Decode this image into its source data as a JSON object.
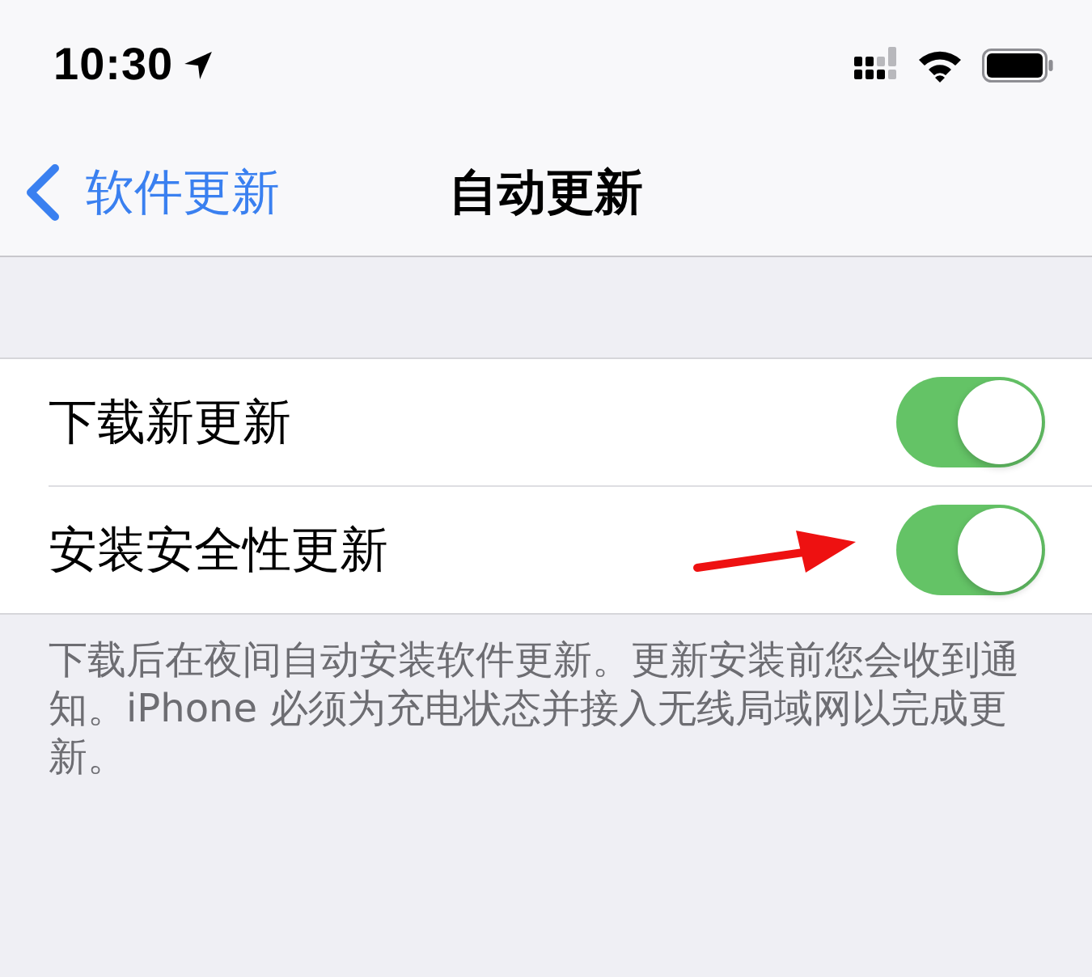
{
  "status_bar": {
    "time": "10:30"
  },
  "nav": {
    "back_label": "软件更新",
    "title": "自动更新"
  },
  "rows": [
    {
      "label": "下载新更新",
      "on": true
    },
    {
      "label": "安装安全性更新",
      "on": true,
      "annotated": true
    }
  ],
  "footer": "下载后在夜间自动安装软件更新。更新安装前您会收到通知。iPhone 必须为充电状态并接入无线局域网以完成更新。"
}
